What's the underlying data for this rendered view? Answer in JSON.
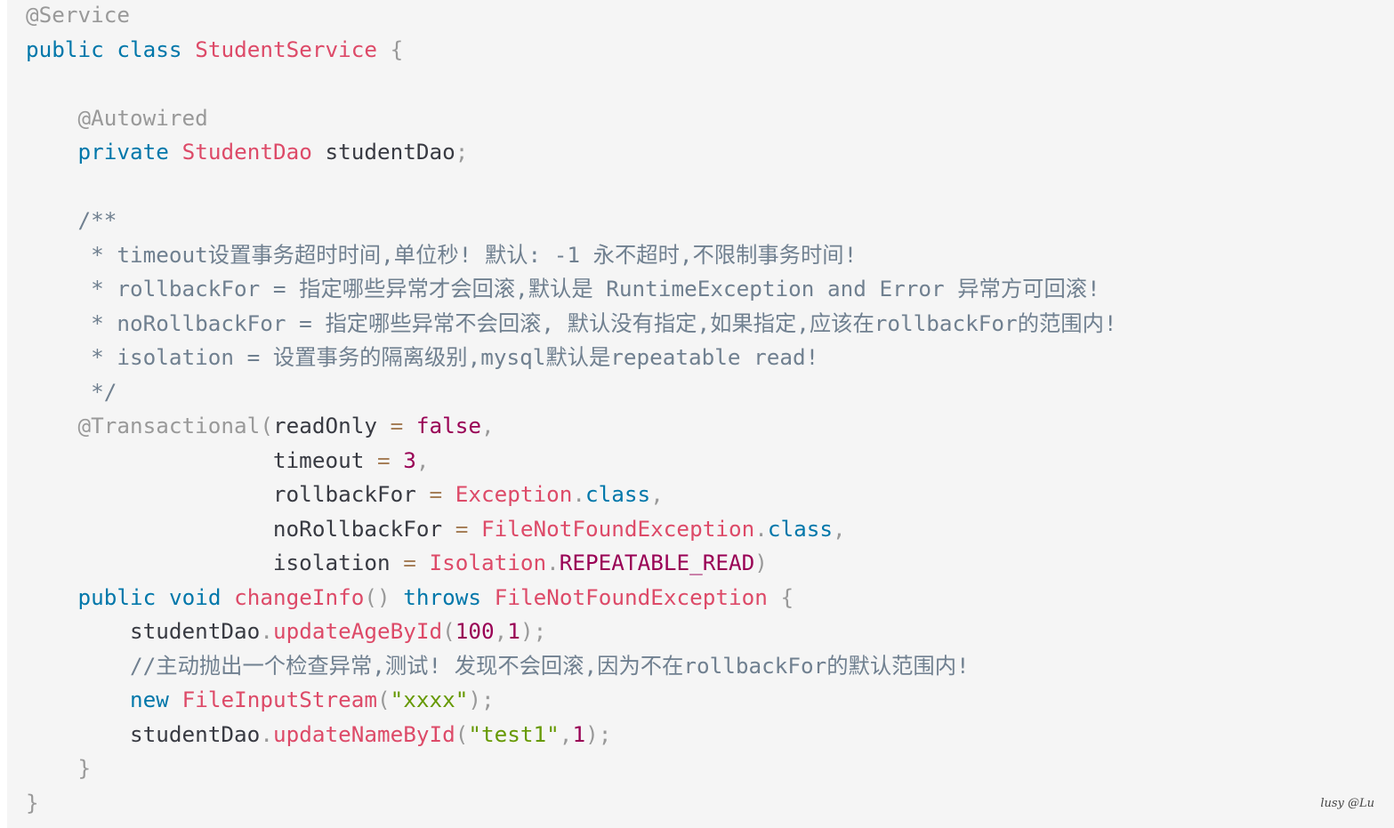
{
  "code_lines": [
    [
      {
        "t": "@Service",
        "c": "anno"
      }
    ],
    [
      {
        "t": "public",
        "c": "kw"
      },
      {
        "t": " ",
        "c": "txt"
      },
      {
        "t": "class",
        "c": "kw"
      },
      {
        "t": " ",
        "c": "txt"
      },
      {
        "t": "StudentService",
        "c": "cls"
      },
      {
        "t": " ",
        "c": "txt"
      },
      {
        "t": "{",
        "c": "punc"
      }
    ],
    [],
    [
      {
        "t": "    ",
        "c": "txt"
      },
      {
        "t": "@Autowired",
        "c": "anno"
      }
    ],
    [
      {
        "t": "    ",
        "c": "txt"
      },
      {
        "t": "private",
        "c": "kw"
      },
      {
        "t": " ",
        "c": "txt"
      },
      {
        "t": "StudentDao",
        "c": "cls"
      },
      {
        "t": " studentDao",
        "c": "txt"
      },
      {
        "t": ";",
        "c": "punc"
      }
    ],
    [],
    [
      {
        "t": "    /**",
        "c": "cmt"
      }
    ],
    [
      {
        "t": "     * timeout设置事务超时时间,单位秒! 默认: -1 永不超时,不限制事务时间!",
        "c": "cmt"
      }
    ],
    [
      {
        "t": "     * rollbackFor = 指定哪些异常才会回滚,默认是 RuntimeException and Error 异常方可回滚!",
        "c": "cmt"
      }
    ],
    [
      {
        "t": "     * noRollbackFor = 指定哪些异常不会回滚, 默认没有指定,如果指定,应该在rollbackFor的范围内!",
        "c": "cmt"
      }
    ],
    [
      {
        "t": "     * isolation = 设置事务的隔离级别,mysql默认是repeatable read!",
        "c": "cmt"
      }
    ],
    [
      {
        "t": "     */",
        "c": "cmt"
      }
    ],
    [
      {
        "t": "    ",
        "c": "txt"
      },
      {
        "t": "@Transactional",
        "c": "anno"
      },
      {
        "t": "(",
        "c": "punc"
      },
      {
        "t": "readOnly ",
        "c": "txt"
      },
      {
        "t": "=",
        "c": "op"
      },
      {
        "t": " ",
        "c": "txt"
      },
      {
        "t": "false",
        "c": "bool"
      },
      {
        "t": ",",
        "c": "punc"
      }
    ],
    [
      {
        "t": "                   timeout ",
        "c": "txt"
      },
      {
        "t": "=",
        "c": "op"
      },
      {
        "t": " ",
        "c": "txt"
      },
      {
        "t": "3",
        "c": "num"
      },
      {
        "t": ",",
        "c": "punc"
      }
    ],
    [
      {
        "t": "                   rollbackFor ",
        "c": "txt"
      },
      {
        "t": "=",
        "c": "op"
      },
      {
        "t": " ",
        "c": "txt"
      },
      {
        "t": "Exception",
        "c": "cls"
      },
      {
        "t": ".",
        "c": "punc"
      },
      {
        "t": "class",
        "c": "kw"
      },
      {
        "t": ",",
        "c": "punc"
      }
    ],
    [
      {
        "t": "                   noRollbackFor ",
        "c": "txt"
      },
      {
        "t": "=",
        "c": "op"
      },
      {
        "t": " ",
        "c": "txt"
      },
      {
        "t": "FileNotFoundException",
        "c": "cls"
      },
      {
        "t": ".",
        "c": "punc"
      },
      {
        "t": "class",
        "c": "kw"
      },
      {
        "t": ",",
        "c": "punc"
      }
    ],
    [
      {
        "t": "                   isolation ",
        "c": "txt"
      },
      {
        "t": "=",
        "c": "op"
      },
      {
        "t": " ",
        "c": "txt"
      },
      {
        "t": "Isolation",
        "c": "cls"
      },
      {
        "t": ".",
        "c": "punc"
      },
      {
        "t": "REPEATABLE_READ",
        "c": "const"
      },
      {
        "t": ")",
        "c": "punc"
      }
    ],
    [
      {
        "t": "    ",
        "c": "txt"
      },
      {
        "t": "public",
        "c": "kw"
      },
      {
        "t": " ",
        "c": "txt"
      },
      {
        "t": "void",
        "c": "kw"
      },
      {
        "t": " ",
        "c": "txt"
      },
      {
        "t": "changeInfo",
        "c": "fn"
      },
      {
        "t": "()",
        "c": "punc"
      },
      {
        "t": " ",
        "c": "txt"
      },
      {
        "t": "throws",
        "c": "kw"
      },
      {
        "t": " ",
        "c": "txt"
      },
      {
        "t": "FileNotFoundException",
        "c": "cls"
      },
      {
        "t": " ",
        "c": "txt"
      },
      {
        "t": "{",
        "c": "punc"
      }
    ],
    [
      {
        "t": "        studentDao",
        "c": "txt"
      },
      {
        "t": ".",
        "c": "punc"
      },
      {
        "t": "updateAgeById",
        "c": "fn"
      },
      {
        "t": "(",
        "c": "punc"
      },
      {
        "t": "100",
        "c": "num"
      },
      {
        "t": ",",
        "c": "punc"
      },
      {
        "t": "1",
        "c": "num"
      },
      {
        "t": ");",
        "c": "punc"
      }
    ],
    [
      {
        "t": "        ",
        "c": "txt"
      },
      {
        "t": "//主动抛出一个检查异常,测试! 发现不会回滚,因为不在rollbackFor的默认范围内!",
        "c": "cmt"
      }
    ],
    [
      {
        "t": "        ",
        "c": "txt"
      },
      {
        "t": "new",
        "c": "kw"
      },
      {
        "t": " ",
        "c": "txt"
      },
      {
        "t": "FileInputStream",
        "c": "cls"
      },
      {
        "t": "(",
        "c": "punc"
      },
      {
        "t": "\"xxxx\"",
        "c": "str"
      },
      {
        "t": ");",
        "c": "punc"
      }
    ],
    [
      {
        "t": "        studentDao",
        "c": "txt"
      },
      {
        "t": ".",
        "c": "punc"
      },
      {
        "t": "updateNameById",
        "c": "fn"
      },
      {
        "t": "(",
        "c": "punc"
      },
      {
        "t": "\"test1\"",
        "c": "str"
      },
      {
        "t": ",",
        "c": "punc"
      },
      {
        "t": "1",
        "c": "num"
      },
      {
        "t": ");",
        "c": "punc"
      }
    ],
    [
      {
        "t": "    ",
        "c": "txt"
      },
      {
        "t": "}",
        "c": "punc"
      }
    ],
    [
      {
        "t": "}",
        "c": "punc"
      }
    ]
  ],
  "watermark": "lusy @Lu"
}
